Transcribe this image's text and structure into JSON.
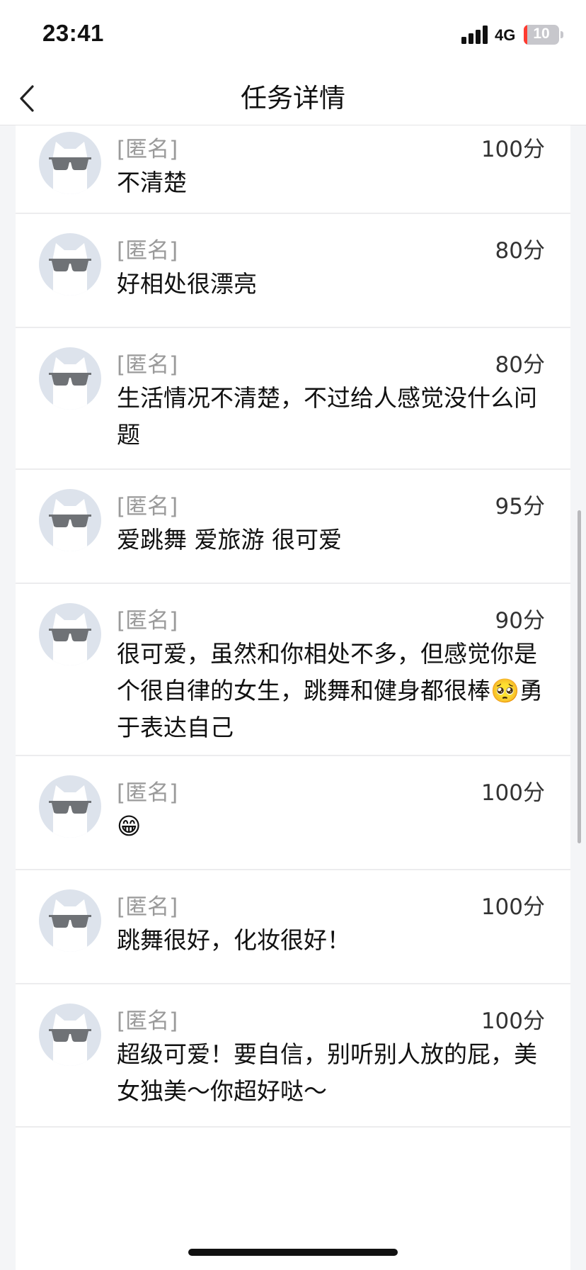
{
  "status_bar": {
    "time": "23:41",
    "network": "4G",
    "battery": "10",
    "battery_fraction": 0.1
  },
  "nav": {
    "title": "任务详情",
    "back_icon": "chevron-left-icon"
  },
  "avatar_icon": "sunglasses-cat-avatar-icon",
  "comments": [
    {
      "name": "[匿名]",
      "score": "100分",
      "text": "不清楚"
    },
    {
      "name": "[匿名]",
      "score": "80分",
      "text": "好相处很漂亮"
    },
    {
      "name": "[匿名]",
      "score": "80分",
      "text": "生活情况不清楚，不过给人感觉没什么问题"
    },
    {
      "name": "[匿名]",
      "score": "95分",
      "text": "爱跳舞 爱旅游 很可爱"
    },
    {
      "name": "[匿名]",
      "score": "90分",
      "text": "很可爱，虽然和你相处不多，但感觉你是个很自律的女生，跳舞和健身都很棒🥺勇于表达自己"
    },
    {
      "name": "[匿名]",
      "score": "100分",
      "text": "😁"
    },
    {
      "name": "[匿名]",
      "score": "100分",
      "text": "跳舞很好，化妆很好！"
    },
    {
      "name": "[匿名]",
      "score": "100分",
      "text": "超级可爱！要自信，别听别人放的屁，美女独美～你超好哒～"
    }
  ]
}
